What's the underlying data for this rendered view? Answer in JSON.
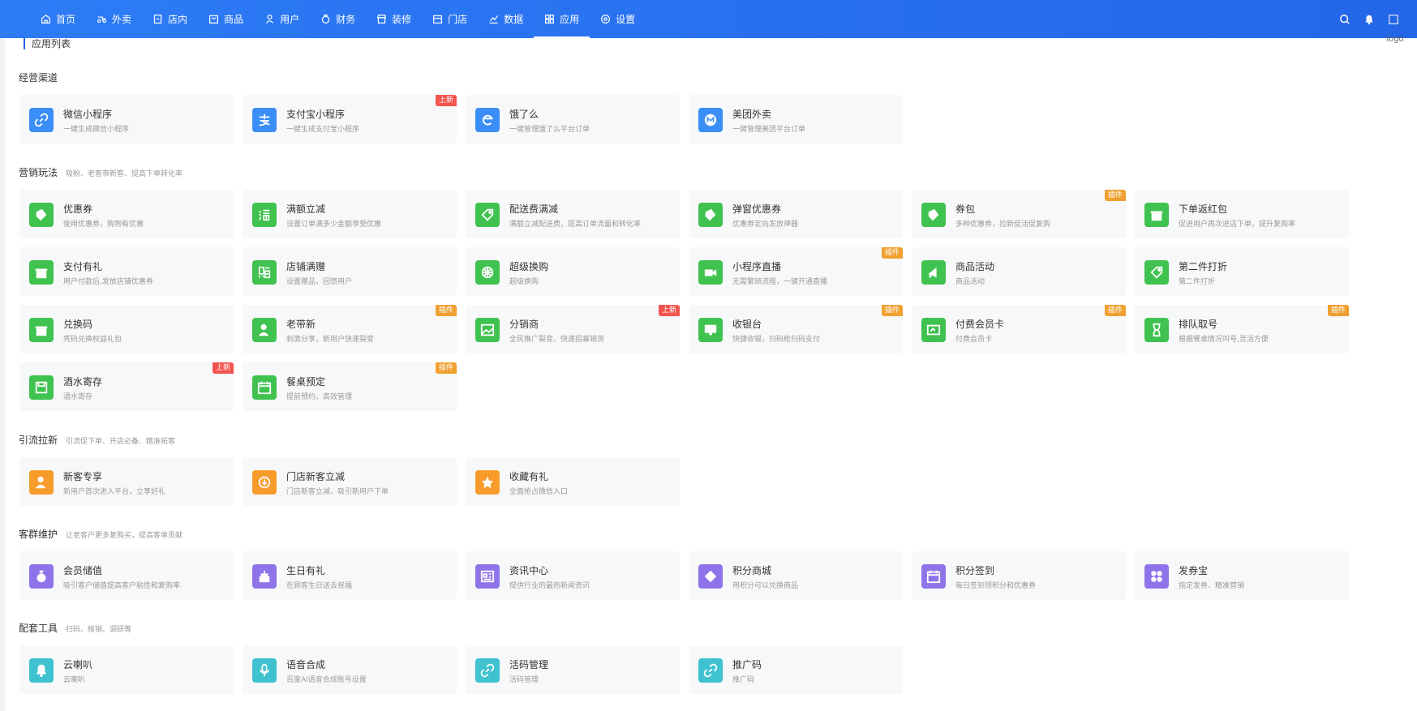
{
  "nav": {
    "items": [
      {
        "label": "首页",
        "icon": "home-icon"
      },
      {
        "label": "外卖",
        "icon": "delivery-icon"
      },
      {
        "label": "店内",
        "icon": "store-inside-icon"
      },
      {
        "label": "商品",
        "icon": "goods-icon"
      },
      {
        "label": "用户",
        "icon": "user-icon"
      },
      {
        "label": "财务",
        "icon": "finance-icon"
      },
      {
        "label": "装修",
        "icon": "decoration-icon"
      },
      {
        "label": "门店",
        "icon": "shop-icon"
      },
      {
        "label": "数据",
        "icon": "chart-icon"
      },
      {
        "label": "应用",
        "icon": "apps-icon"
      },
      {
        "label": "设置",
        "icon": "gear-icon"
      }
    ],
    "active": "应用"
  },
  "header": {
    "logo_alt": "logo"
  },
  "page": {
    "title": "应用列表"
  },
  "sections": {
    "channels": {
      "title": "经营渠道",
      "subtitle": "",
      "cards": [
        {
          "name": "微信小程序",
          "desc": "一键生成微信小程序",
          "badge": ""
        },
        {
          "name": "支付宝小程序",
          "desc": "一键生成支付宝小程序",
          "badge": "上新"
        },
        {
          "name": "饿了么",
          "desc": "一键管理饿了么平台订单",
          "badge": ""
        },
        {
          "name": "美团外卖",
          "desc": "一键管理美团平台订单",
          "badge": ""
        }
      ]
    },
    "marketing": {
      "title": "营销玩法",
      "subtitle": "吸粉、老客带新客、提高下单转化率",
      "cards": [
        {
          "name": "优惠券",
          "desc": "使用优惠券，购物有优惠",
          "badge": ""
        },
        {
          "name": "满额立减",
          "desc": "设置订单满多少金额享受优惠",
          "badge": ""
        },
        {
          "name": "配送费满减",
          "desc": "满额立减配送费，提高订单流量和转化率",
          "badge": ""
        },
        {
          "name": "弹窗优惠券",
          "desc": "优惠券定向发放神器",
          "badge": ""
        },
        {
          "name": "券包",
          "desc": "多种优惠券，拉新促活促复购",
          "badge": "插件"
        },
        {
          "name": "下单返红包",
          "desc": "促进用户再次进店下单，提升复购率",
          "badge": ""
        },
        {
          "name": "支付有礼",
          "desc": "用户付款后,发放店铺优惠券",
          "badge": ""
        },
        {
          "name": "店铺满赠",
          "desc": "设置赠品，回馈用户",
          "badge": ""
        },
        {
          "name": "超级换购",
          "desc": "超级换购",
          "badge": ""
        },
        {
          "name": "小程序直播",
          "desc": "无需繁琐流程，一键开通直播",
          "badge": "插件"
        },
        {
          "name": "商品活动",
          "desc": "商品活动",
          "badge": ""
        },
        {
          "name": "第二件打折",
          "desc": "第二件打折",
          "badge": ""
        },
        {
          "name": "兑换码",
          "desc": "凭码兑换权益礼包",
          "badge": ""
        },
        {
          "name": "老带新",
          "desc": "刺激分享，新用户快速裂变",
          "badge": "插件"
        },
        {
          "name": "分销商",
          "desc": "全民推广裂变、快速招募销货",
          "badge": "上新"
        },
        {
          "name": "收银台",
          "desc": "快捷收银，扫码枪扫码支付",
          "badge": "插件"
        },
        {
          "name": "付费会员卡",
          "desc": "付费会员卡",
          "badge": "插件"
        },
        {
          "name": "排队取号",
          "desc": "根据餐桌情况叫号,灵活方便",
          "badge": "插件"
        },
        {
          "name": "酒水寄存",
          "desc": "酒水寄存",
          "badge": "上新"
        },
        {
          "name": "餐桌预定",
          "desc": "提前预约，高效管理",
          "badge": "插件"
        }
      ]
    },
    "traffic": {
      "title": "引流拉新",
      "subtitle": "引流促下单、开店必备、精准拓客",
      "cards": [
        {
          "name": "新客专享",
          "desc": "新用户首次进入平台，立享好礼",
          "badge": ""
        },
        {
          "name": "门店新客立减",
          "desc": "门店新客立减，吸引新用户下单",
          "badge": ""
        },
        {
          "name": "收藏有礼",
          "desc": "全面抢占微信入口",
          "badge": ""
        }
      ]
    },
    "retention": {
      "title": "客群维护",
      "subtitle": "让老客户更多复购买，提高客单贡献",
      "cards": [
        {
          "name": "会员储值",
          "desc": "吸引客户储值提高客户粘性和复购率",
          "badge": ""
        },
        {
          "name": "生日有礼",
          "desc": "在顾客生日送去祝福",
          "badge": ""
        },
        {
          "name": "资讯中心",
          "desc": "提供行业的最热新闻资讯",
          "badge": ""
        },
        {
          "name": "积分商城",
          "desc": "用积分可以兑换商品",
          "badge": ""
        },
        {
          "name": "积分签到",
          "desc": "每日签到领积分和优惠券",
          "badge": ""
        },
        {
          "name": "发券宝",
          "desc": "指定发券、精准营销",
          "badge": ""
        }
      ]
    },
    "tools": {
      "title": "配套工具",
      "subtitle": "扫码、核销、调研等",
      "cards": [
        {
          "name": "云喇叭",
          "desc": "云喇叭",
          "badge": ""
        },
        {
          "name": "语音合成",
          "desc": "百度AI语音合成账号设置",
          "badge": ""
        },
        {
          "name": "活码管理",
          "desc": "活码管理",
          "badge": ""
        },
        {
          "name": "推广码",
          "desc": "推广码",
          "badge": ""
        }
      ]
    }
  },
  "colors": {
    "nav_bg": "#2466e8",
    "channels_icon": "#3a8ef6",
    "marketing_icon": "#3fc24f",
    "traffic_icon": "#f79c2a",
    "retention_icon": "#8e74e8",
    "tools_icon": "#3ec2d0",
    "badge_plugin": "#f0a030",
    "badge_new": "#f2544f"
  }
}
